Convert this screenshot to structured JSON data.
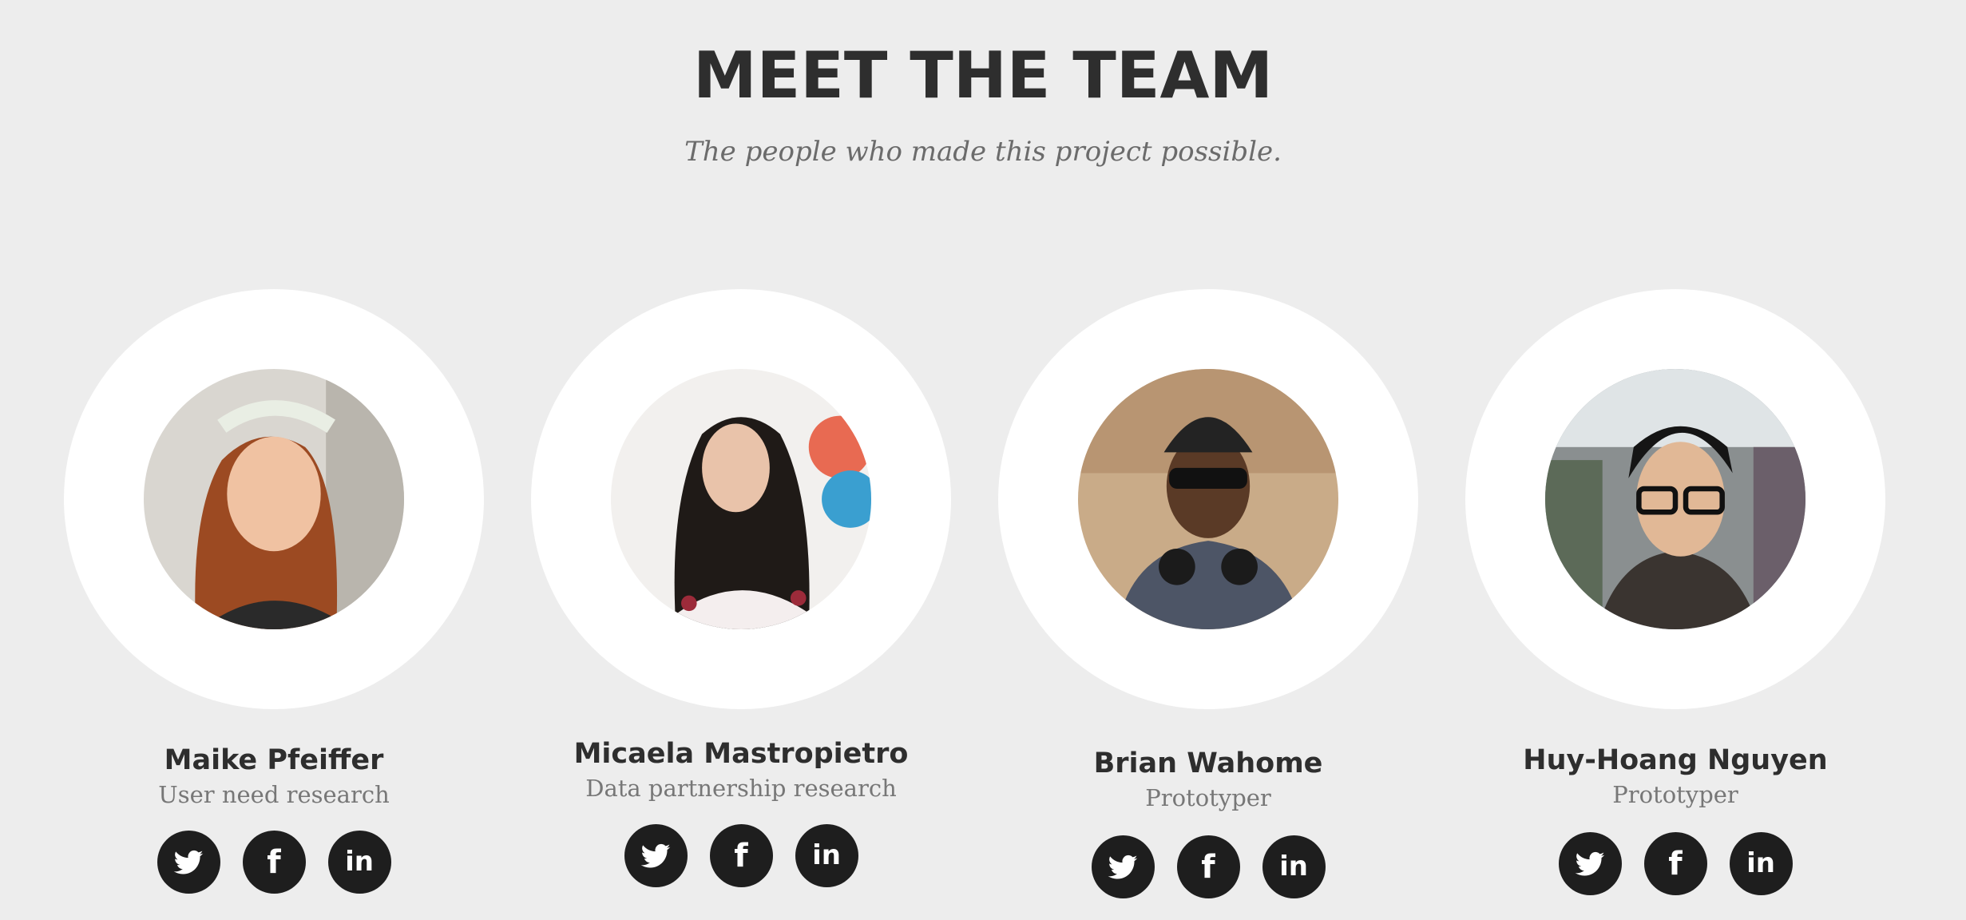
{
  "header": {
    "title": "MEET THE TEAM",
    "subtitle": "The people who made this project possible."
  },
  "colors": {
    "background": "#ededed",
    "ring": "#ffffff",
    "social_button": "#1e1e1e",
    "name_text": "#2e2e2e",
    "role_text": "#777777"
  },
  "members": [
    {
      "name": "Maike Pfeiffer",
      "role": "User need research",
      "socials": [
        "twitter-icon",
        "facebook-icon",
        "linkedin-icon"
      ]
    },
    {
      "name": "Micaela Mastropietro",
      "role": "Data partnership research",
      "socials": [
        "twitter-icon",
        "facebook-icon",
        "linkedin-icon"
      ]
    },
    {
      "name": "Brian Wahome",
      "role": "Prototyper",
      "socials": [
        "twitter-icon",
        "facebook-icon",
        "linkedin-icon"
      ]
    },
    {
      "name": "Huy-Hoang Nguyen",
      "role": "Prototyper",
      "socials": [
        "twitter-icon",
        "facebook-icon",
        "linkedin-icon"
      ]
    }
  ]
}
